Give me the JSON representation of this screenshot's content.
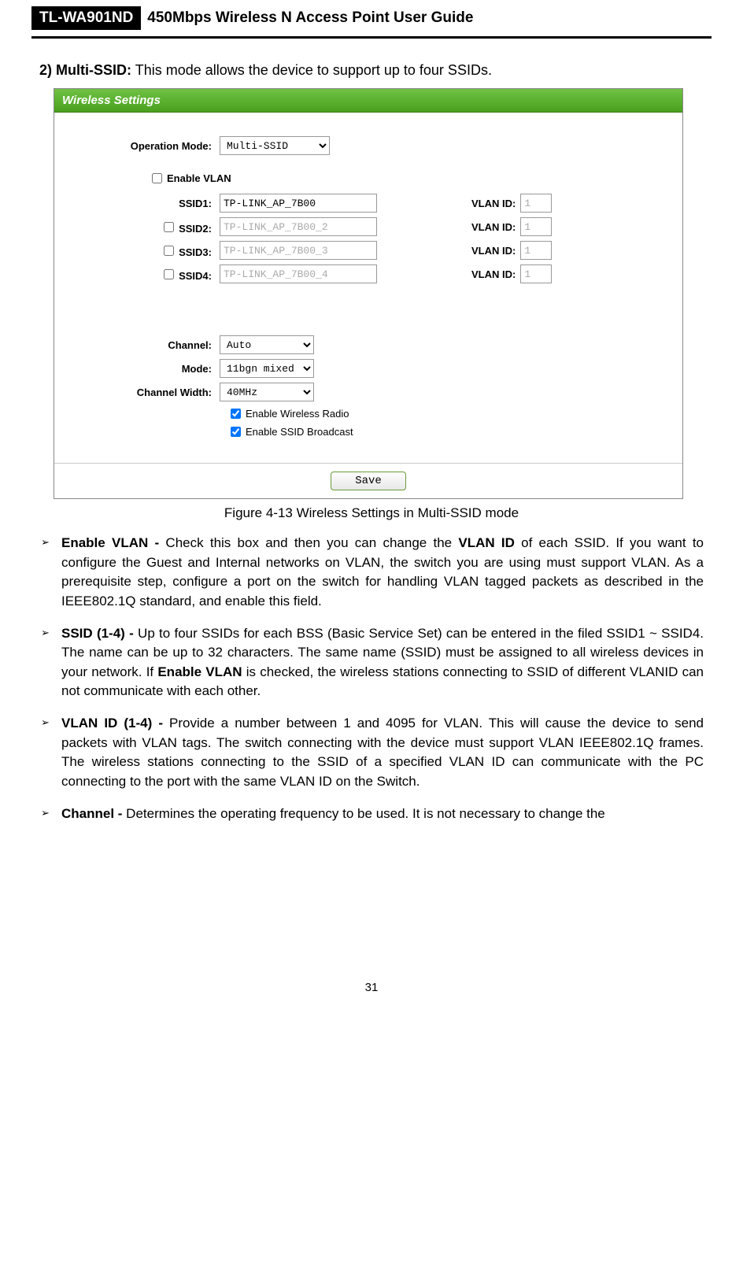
{
  "header": {
    "model": "TL-WA901ND",
    "title": "450Mbps Wireless N Access Point User Guide"
  },
  "intro": {
    "num": "2)",
    "label": "Multi-SSID:",
    "text": "This mode allows the device to support up to four SSIDs."
  },
  "panel": {
    "title": "Wireless Settings",
    "op_mode_label": "Operation Mode:",
    "op_mode_value": "Multi-SSID",
    "enable_vlan_label": "Enable VLAN",
    "ssid_rows": [
      {
        "label": "SSID1:",
        "value": "TP-LINK_AP_7B00",
        "enabled": true,
        "checkbox": false,
        "vlan": "1"
      },
      {
        "label": "SSID2:",
        "value": "TP-LINK_AP_7B00_2",
        "enabled": false,
        "checkbox": true,
        "vlan": "1"
      },
      {
        "label": "SSID3:",
        "value": "TP-LINK_AP_7B00_3",
        "enabled": false,
        "checkbox": true,
        "vlan": "1"
      },
      {
        "label": "SSID4:",
        "value": "TP-LINK_AP_7B00_4",
        "enabled": false,
        "checkbox": true,
        "vlan": "1"
      }
    ],
    "vlan_id_label": "VLAN ID:",
    "channel_label": "Channel:",
    "channel_value": "Auto",
    "mode_label": "Mode:",
    "mode_value": "11bgn mixed",
    "chwidth_label": "Channel Width:",
    "chwidth_value": "40MHz",
    "enable_radio": "Enable Wireless Radio",
    "enable_broadcast": "Enable SSID Broadcast",
    "save": "Save"
  },
  "figure_caption": "Figure 4-13 Wireless Settings in Multi-SSID mode",
  "bullets": [
    {
      "b": "Enable VLAN - ",
      "t1": "Check this box and then you can change the ",
      "b2": "VLAN ID",
      "t2": " of each SSID. If you want to configure the Guest and Internal networks on VLAN, the switch you are using must support VLAN. As a prerequisite step, configure a port on the switch for handling VLAN tagged packets as described in the IEEE802.1Q standard, and enable this field."
    },
    {
      "b": "SSID (1-4) - ",
      "t1": "Up to four SSIDs for each BSS (Basic Service Set) can be entered in the filed SSID1 ~ SSID4. The name can be up to 32 characters. The same name (SSID) must be assigned to all wireless devices in your network. If ",
      "b2": "Enable VLAN",
      "t2": " is checked, the wireless stations connecting to SSID of different VLANID can not communicate with each other."
    },
    {
      "b": "VLAN ID (1-4) - ",
      "t1": "Provide a number between 1 and 4095 for VLAN. This will cause the device to send packets with VLAN tags. The switch connecting with the device must support VLAN IEEE802.1Q frames. The wireless stations connecting to the SSID of a specified VLAN ID can communicate with the PC connecting to the port with the same VLAN ID on the Switch.",
      "b2": "",
      "t2": ""
    },
    {
      "b": "Channel - ",
      "t1": "Determines the operating frequency to be used. It is not necessary to change the",
      "b2": "",
      "t2": ""
    }
  ],
  "page_num": "31"
}
